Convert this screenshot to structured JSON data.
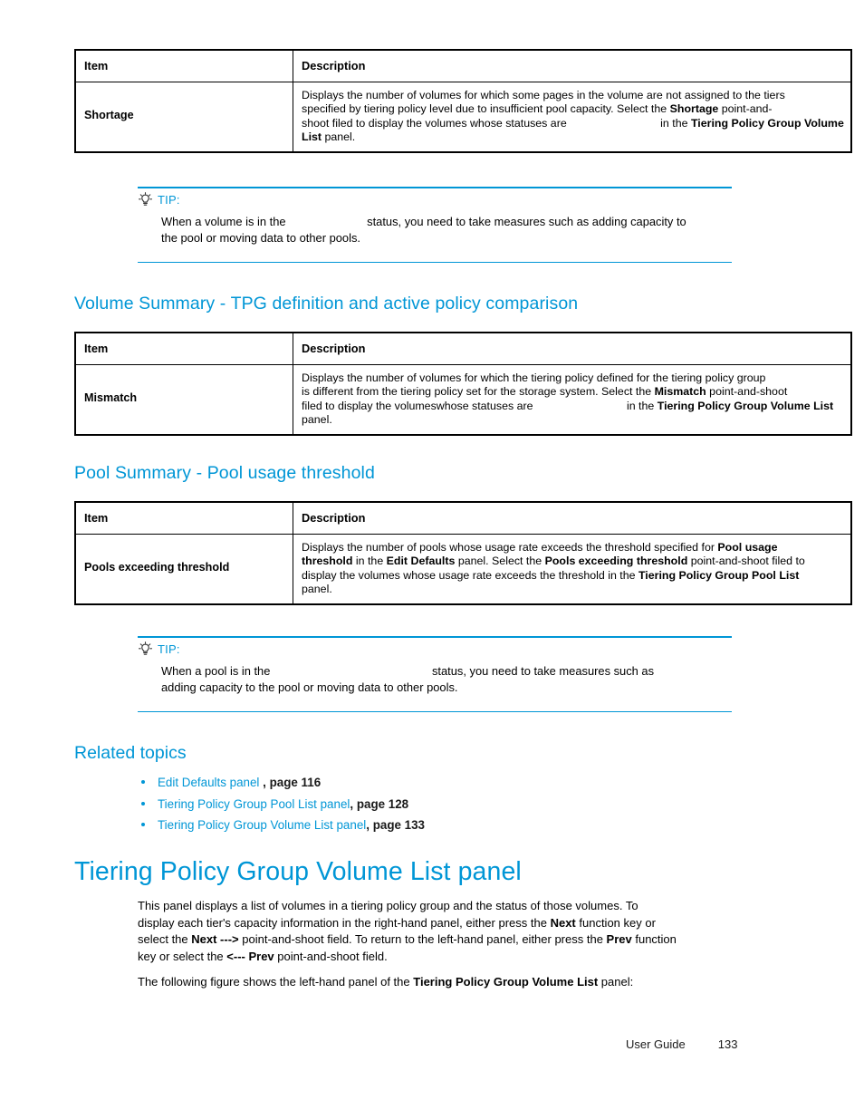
{
  "document": {
    "footer": {
      "guide_label": "User Guide",
      "page_number": "133"
    }
  },
  "tables": [
    {
      "id": "shortage-table",
      "headers": {
        "item": "Item",
        "description": "Description"
      },
      "row": {
        "item": "Shortage",
        "desc_lines": [
          {
            "segments": [
              {
                "t": "Displays the number of volumes for which some pages in the volume are not assigned to the tiers",
                "b": false
              }
            ]
          },
          {
            "segments": [
              {
                "t": "specified by tiering policy level due to insufficient pool capacity. Select the ",
                "b": false
              },
              {
                "t": "Shortage",
                "b": true
              },
              {
                "t": " point-and-",
                "b": false
              }
            ]
          },
          {
            "segments": [
              {
                "t": "shoot filed to display the volumes whose statuses are ",
                "b": false
              },
              {
                "t": "",
                "gap": "md"
              },
              {
                "t": "in the ",
                "b": false
              },
              {
                "t": "Tiering Policy Group Volume",
                "b": true
              }
            ]
          },
          {
            "segments": [
              {
                "t": "List",
                "b": true
              },
              {
                "t": " panel.",
                "b": false
              }
            ]
          }
        ]
      }
    },
    {
      "id": "mismatch-table",
      "headers": {
        "item": "Item",
        "description": "Description"
      },
      "row": {
        "item": "Mismatch",
        "desc_lines": [
          {
            "segments": [
              {
                "t": "Displays the number of volumes for which the tiering policy defined for the tiering policy group",
                "b": false
              }
            ]
          },
          {
            "segments": [
              {
                "t": "is different from the tiering policy set for the storage system. Select the ",
                "b": false
              },
              {
                "t": "Mismatch",
                "b": true
              },
              {
                "t": " point-and-shoot",
                "b": false
              }
            ]
          },
          {
            "segments": [
              {
                "t": "filed to display the volumeswhose statuses are ",
                "b": false
              },
              {
                "t": "",
                "gap": "md"
              },
              {
                "t": "in the ",
                "b": false
              },
              {
                "t": "Tiering Policy Group Volume List",
                "b": true
              }
            ]
          },
          {
            "segments": [
              {
                "t": "panel.",
                "b": false
              }
            ]
          }
        ]
      }
    },
    {
      "id": "pools-exceeding-threshold-table",
      "headers": {
        "item": "Item",
        "description": "Description"
      },
      "row": {
        "item": "Pools exceeding threshold",
        "desc_lines": [
          {
            "segments": [
              {
                "t": "Displays the number of pools whose usage rate exceeds the threshold specified for ",
                "b": false
              },
              {
                "t": "Pool usage",
                "b": true
              }
            ]
          },
          {
            "segments": [
              {
                "t": "threshold",
                "b": true
              },
              {
                "t": " in the ",
                "b": false
              },
              {
                "t": "Edit Defaults",
                "b": true
              },
              {
                "t": " panel. Select the ",
                "b": false
              },
              {
                "t": "Pools exceeding threshold",
                "b": true
              },
              {
                "t": " point-and-shoot filed to",
                "b": false
              }
            ]
          },
          {
            "segments": [
              {
                "t": "display the volumes whose usage rate exceeds the threshold in the ",
                "b": false
              },
              {
                "t": "Tiering Policy Group Pool List",
                "b": true
              }
            ]
          },
          {
            "segments": [
              {
                "t": "panel.",
                "b": false
              }
            ]
          }
        ]
      }
    }
  ],
  "tips": [
    {
      "id": "volume-tip",
      "icon": "lightbulb-icon",
      "label": "TIP:",
      "lines": [
        {
          "segments": [
            {
              "t": "When a volume is in the ",
              "b": false
            },
            {
              "t": "",
              "gap": "sm"
            },
            {
              "t": "status, you need to take measures such as adding capacity to",
              "b": false
            }
          ]
        },
        {
          "segments": [
            {
              "t": "the pool or moving data to other pools.",
              "b": false
            }
          ]
        }
      ]
    },
    {
      "id": "pool-tip",
      "icon": "lightbulb-icon",
      "label": "TIP:",
      "lines": [
        {
          "segments": [
            {
              "t": "When a pool is in the ",
              "b": false
            },
            {
              "t": "",
              "gap": "lg"
            },
            {
              "t": "status, you need to take measures such as",
              "b": false
            }
          ]
        },
        {
          "segments": [
            {
              "t": "adding capacity to the pool or moving data to other pools.",
              "b": false
            }
          ]
        }
      ]
    }
  ],
  "headings": {
    "volume_summary": "Volume Summary - TPG definition and active policy comparison",
    "pool_summary": "Pool Summary - Pool usage threshold",
    "related_topics": "Related topics",
    "tiering_policy_group_volume_list_panel": "Tiering Policy Group Volume List panel"
  },
  "related_topics": [
    {
      "link": "Edit Defaults panel ",
      "page": ", page 116"
    },
    {
      "link": "Tiering Policy Group Pool List panel",
      "page": ", page 128"
    },
    {
      "link": "Tiering Policy Group Volume List panel",
      "page": ", page 133"
    }
  ],
  "paragraphs": [
    {
      "id": "panel-intro",
      "lines": [
        {
          "segments": [
            {
              "t": "This panel displays a list of volumes in a tiering policy group and the status of those volumes. To",
              "b": false
            }
          ]
        },
        {
          "segments": [
            {
              "t": "display each tier's capacity information in the right-hand panel, either press the ",
              "b": false
            },
            {
              "t": "Next",
              "b": true
            },
            {
              "t": " function key or",
              "b": false
            }
          ]
        },
        {
          "segments": [
            {
              "t": "select the ",
              "b": false
            },
            {
              "t": "Next --->",
              "b": true
            },
            {
              "t": " point-and-shoot field. To return to the left-hand panel, either press the ",
              "b": false
            },
            {
              "t": "Prev",
              "b": true
            },
            {
              "t": " function",
              "b": false
            }
          ]
        },
        {
          "segments": [
            {
              "t": "key or select the ",
              "b": false
            },
            {
              "t": "<--- Prev",
              "b": true
            },
            {
              "t": " point-and-shoot field.",
              "b": false
            }
          ]
        }
      ]
    },
    {
      "id": "figure-intro",
      "lines": [
        {
          "segments": [
            {
              "t": "The following figure shows the left-hand panel of the ",
              "b": false
            },
            {
              "t": "Tiering Policy Group Volume List",
              "b": true
            },
            {
              "t": " panel:",
              "b": false
            }
          ]
        }
      ]
    }
  ],
  "colors": {
    "accent_blue": "#0096d6",
    "text_black": "#000000"
  }
}
